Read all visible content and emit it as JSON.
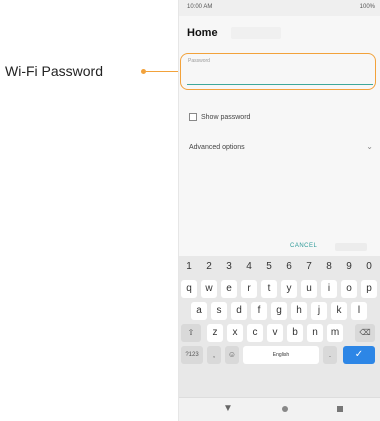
{
  "callout": {
    "label": "Wi-Fi Password",
    "accent_color": "#f2a23b"
  },
  "status_bar": {
    "time": "10:00 AM",
    "battery": "100%"
  },
  "header": {
    "title": "Home"
  },
  "password_field": {
    "label": "Password",
    "value": ""
  },
  "show_password": {
    "label": "Show password",
    "checked": false
  },
  "advanced": {
    "label": "Advanced options",
    "chevron_icon": "chevron-down-icon"
  },
  "actions": {
    "cancel": "CANCEL"
  },
  "keyboard": {
    "numbers": [
      "1",
      "2",
      "3",
      "4",
      "5",
      "6",
      "7",
      "8",
      "9",
      "0"
    ],
    "row1": [
      "q",
      "w",
      "e",
      "r",
      "t",
      "y",
      "u",
      "i",
      "o",
      "p"
    ],
    "row2": [
      "a",
      "s",
      "d",
      "f",
      "g",
      "h",
      "j",
      "k",
      "l"
    ],
    "row3": [
      "z",
      "x",
      "c",
      "v",
      "b",
      "n",
      "m"
    ],
    "shift_icon": "⇧",
    "backspace_icon": "⌫",
    "symbols": "?123",
    "comma": ",",
    "emoji_icon": "☺",
    "space": "English",
    "period": ".",
    "enter_icon": "✓",
    "enter_color": "#2d86e6"
  },
  "nav": {
    "back_icon": "▼",
    "home_icon": "home-icon",
    "recents_icon": "recents-icon"
  }
}
